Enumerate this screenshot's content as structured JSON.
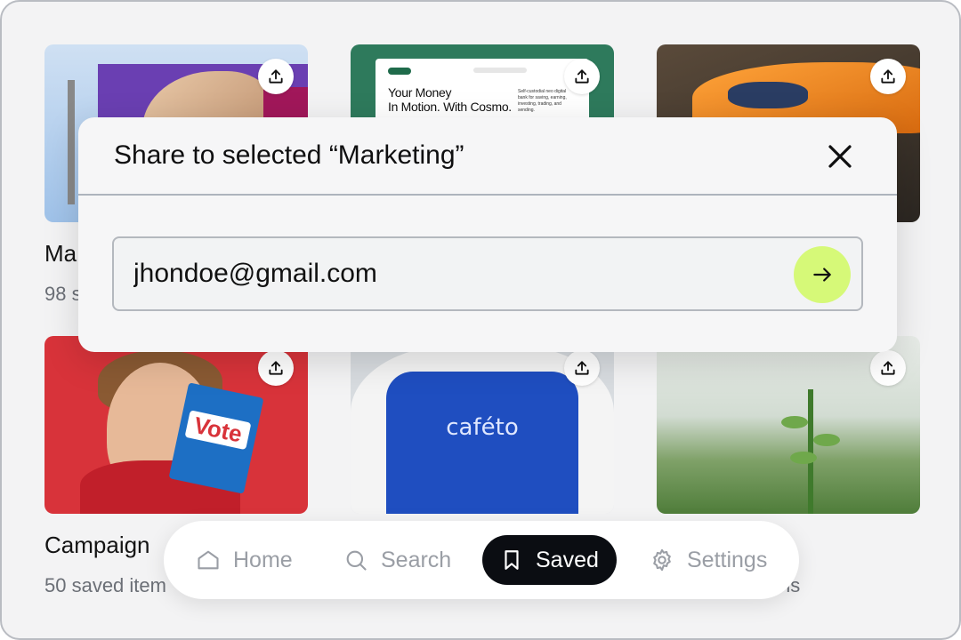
{
  "modal": {
    "title": "Share to selected “Marketing”",
    "email_value": "jhondoe@gmail.com"
  },
  "tiles": [
    {
      "title": "Ma",
      "subtitle": "98 s"
    },
    {
      "title": "Campaign",
      "subtitle": "50 saved item"
    },
    {
      "subtitle_tail": "ns"
    }
  ],
  "thumbs": {
    "cosmo_headline_1": "Your Money",
    "cosmo_headline_2": "In Motion. With Cosmo.",
    "cosmo_small": "Self-custodial neo digital bank for saving, earning, investing, trading, and sending.",
    "vote_label": "Vote",
    "apron_text": "caféto"
  },
  "nav": {
    "items": [
      {
        "label": "Home",
        "icon": "home-icon"
      },
      {
        "label": "Search",
        "icon": "search-icon"
      },
      {
        "label": "Saved",
        "icon": "bookmark-icon",
        "active": true
      },
      {
        "label": "Settings",
        "icon": "gear-icon"
      }
    ]
  },
  "colors": {
    "accent_send": "#d6f978",
    "nav_active": "#0b0d12"
  }
}
